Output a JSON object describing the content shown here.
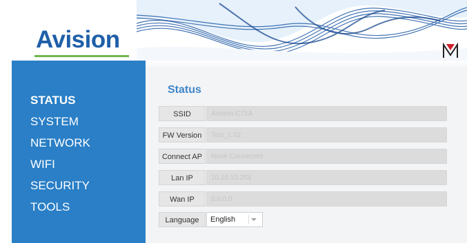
{
  "brand": {
    "logo_text": "Avision",
    "accent": "#1f5fa8",
    "green": "#6fb54b"
  },
  "sidebar": {
    "bg": "#2a7fc6",
    "items": [
      {
        "label": "STATUS",
        "active": true
      },
      {
        "label": "SYSTEM"
      },
      {
        "label": "NETWORK"
      },
      {
        "label": "WIFI"
      },
      {
        "label": "SECURITY"
      },
      {
        "label": "TOOLS"
      }
    ]
  },
  "status": {
    "title": "Status",
    "rows": [
      {
        "label": "SSID",
        "value": "Avision-C71A"
      },
      {
        "label": "FW Version",
        "value": "Test_1.02"
      },
      {
        "label": "Connect AP",
        "value": "None Connected"
      },
      {
        "label": "Lan IP",
        "value": "10.10.10.254"
      },
      {
        "label": "Wan IP",
        "value": "0.0.0.0"
      }
    ],
    "language": {
      "label": "Language",
      "selected": "English"
    }
  },
  "icons": {
    "dropdown": "chevron-down-icon",
    "corner_logo": "m-logo-icon"
  }
}
